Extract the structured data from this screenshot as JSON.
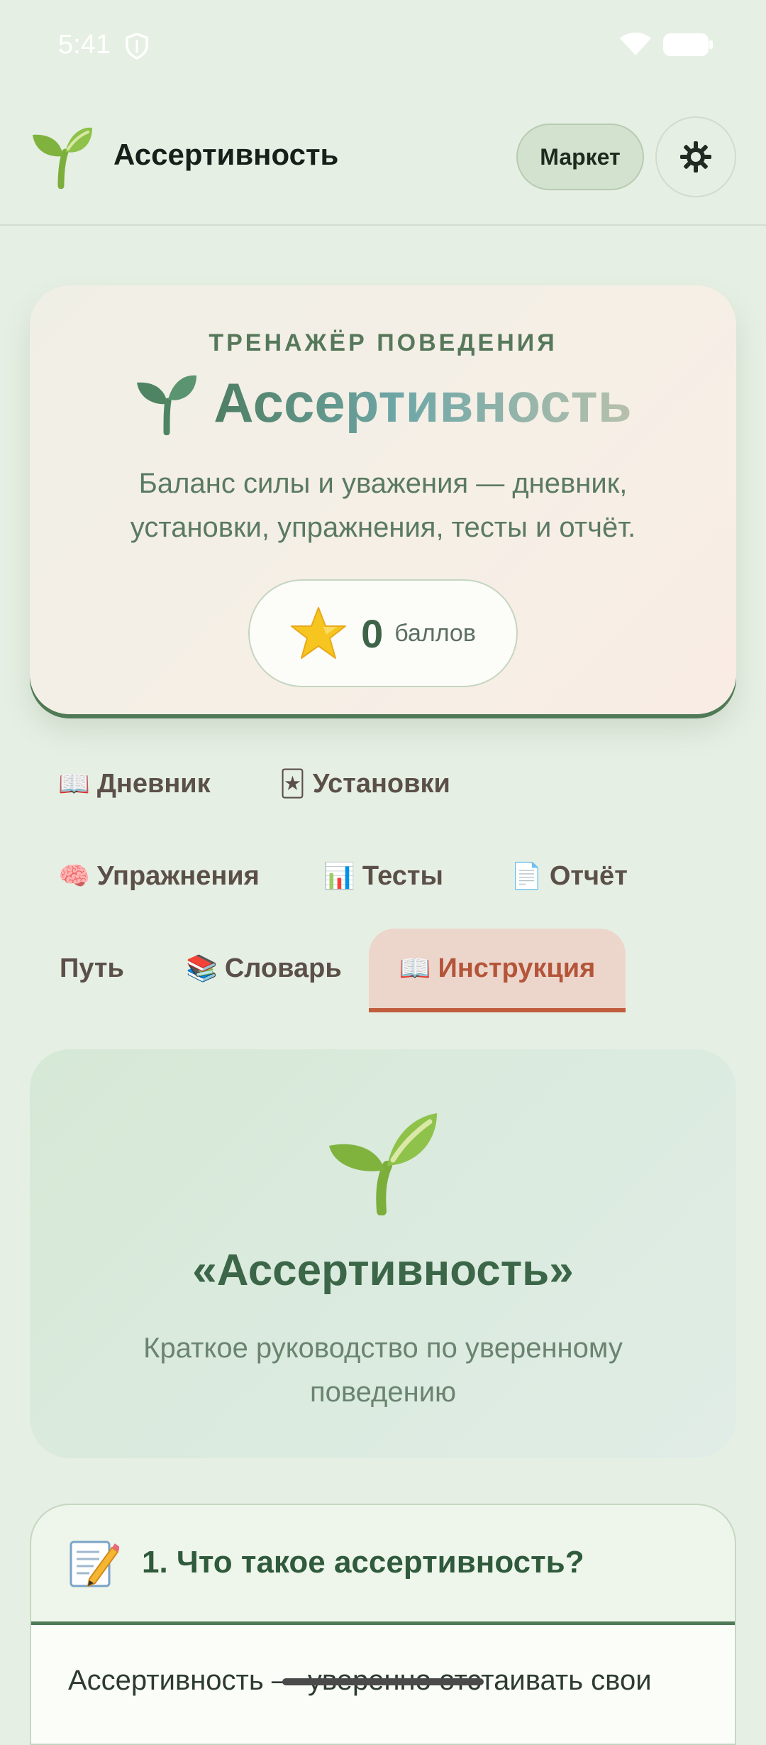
{
  "status_bar": {
    "time": "5:41",
    "shield_icon": "shield-icon",
    "wifi_icon": "wifi-icon",
    "battery_icon": "battery-icon"
  },
  "header": {
    "logo_icon": "sprout-icon",
    "title": "Ассертивность",
    "market_label": "Маркет",
    "settings_icon": "gear-icon"
  },
  "hero": {
    "kicker": "ТРЕНАЖЁР ПОВЕДЕНИЯ",
    "title": "Ассертивность",
    "subtitle": "Баланс силы и уважения — дневник, установки, упражнения, тесты и отчёт.",
    "points_icon": "star-icon",
    "points_value": "0",
    "points_unit": "баллов"
  },
  "tabs": [
    {
      "emoji": "📖",
      "label": "Дневник",
      "active": false
    },
    {
      "emoji": "🃏",
      "label": "Установки",
      "active": false
    },
    {
      "emoji": "🧠",
      "label": "Упражнения",
      "active": false
    },
    {
      "emoji": "📊",
      "label": "Тесты",
      "active": false
    },
    {
      "emoji": "📄",
      "label": "Отчёт",
      "active": false
    },
    {
      "emoji": "",
      "label": "Путь",
      "active": false
    },
    {
      "emoji": "📚",
      "label": "Словарь",
      "active": false
    },
    {
      "emoji": "📖",
      "label": "Инструкция",
      "active": true
    }
  ],
  "guide": {
    "icon": "sprout-icon",
    "title": "«Ассертивность»",
    "subtitle": "Краткое руководство по уверенному поведению"
  },
  "section": {
    "icon": "memo-icon",
    "title": "1. Что такое ассертивность?",
    "text": "Ассертивность — уверенно отстаивать свои"
  },
  "colors": {
    "background": "#e6efe3",
    "accent_green": "#4f7a55",
    "active_tab": "#c05d3e",
    "active_tab_bg": "#ecd6cb"
  }
}
